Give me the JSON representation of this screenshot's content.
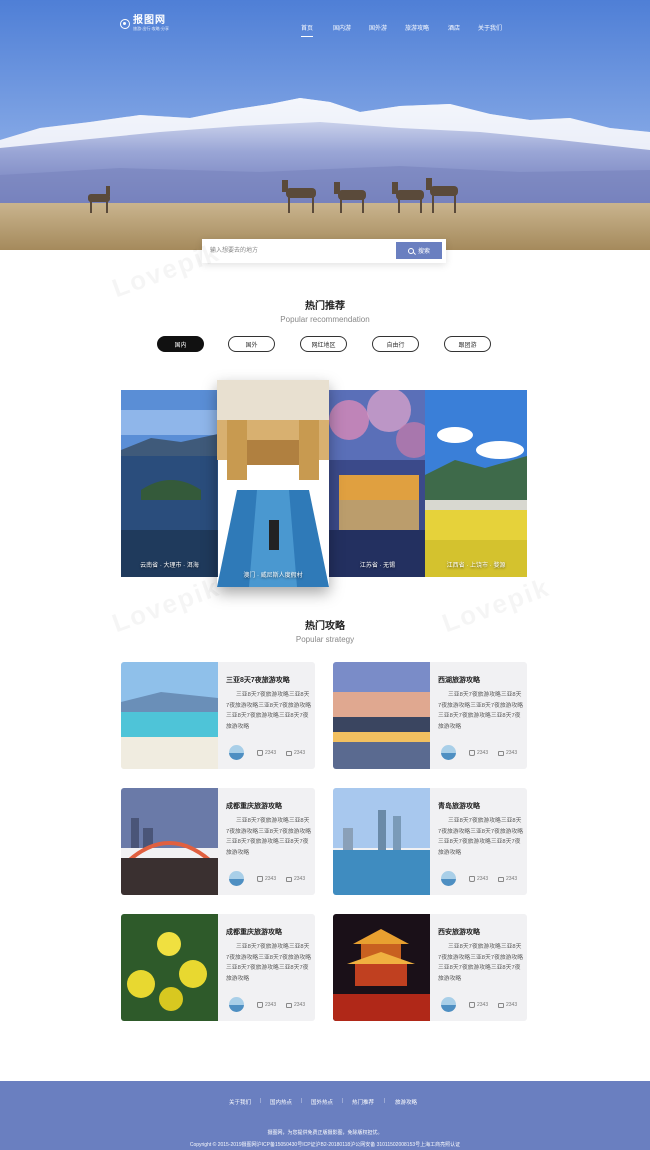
{
  "brand": {
    "name": "报图网",
    "tagline": "旅游·出行·攻略·分享"
  },
  "nav": [
    {
      "label": "首页",
      "active": true
    },
    {
      "label": "国内游",
      "active": false
    },
    {
      "label": "国外游",
      "active": false
    },
    {
      "label": "旅游攻略",
      "active": false
    },
    {
      "label": "酒店",
      "active": false
    },
    {
      "label": "关于我们",
      "active": false
    }
  ],
  "search": {
    "placeholder": "输入想要去的地方",
    "button_label": "搜索"
  },
  "recommend": {
    "title": "热门推荐",
    "subtitle": "Popular recommendation",
    "tabs": [
      {
        "label": "国内",
        "active": true
      },
      {
        "label": "国外",
        "active": false
      },
      {
        "label": "网红地区",
        "active": false
      },
      {
        "label": "自由行",
        "active": false
      },
      {
        "label": "跟团游",
        "active": false
      }
    ],
    "destinations": [
      {
        "label": "云南省 · 大理市 · 洱海"
      },
      {
        "label": "澳门 · 威尼斯人度假村"
      },
      {
        "label": "江苏省 · 无锡"
      },
      {
        "label": "江西省 · 上饶市 · 婺源"
      }
    ]
  },
  "strategy": {
    "title": "热门攻略",
    "subtitle": "Popular strategy",
    "cards": [
      {
        "title": "三亚8天7夜旅游攻略",
        "desc": "三亚8天7夜旅游攻略三亚8天7夜旅游攻略三亚8天7夜旅游攻略三亚8天7夜旅游攻略三亚8天7夜旅游攻略",
        "likes": "2343",
        "comments": "2343"
      },
      {
        "title": "西湖旅游攻略",
        "desc": "三亚8天7夜旅游攻略三亚8天7夜旅游攻略三亚8天7夜旅游攻略三亚8天7夜旅游攻略三亚8天7夜旅游攻略",
        "likes": "2343",
        "comments": "2343"
      },
      {
        "title": "成都重庆旅游攻略",
        "desc": "三亚8天7夜旅游攻略三亚8天7夜旅游攻略三亚8天7夜旅游攻略三亚8天7夜旅游攻略三亚8天7夜旅游攻略",
        "likes": "2343",
        "comments": "2343"
      },
      {
        "title": "青岛旅游攻略",
        "desc": "三亚8天7夜旅游攻略三亚8天7夜旅游攻略三亚8天7夜旅游攻略三亚8天7夜旅游攻略三亚8天7夜旅游攻略",
        "likes": "2343",
        "comments": "2343"
      },
      {
        "title": "成都重庆旅游攻略",
        "desc": "三亚8天7夜旅游攻略三亚8天7夜旅游攻略三亚8天7夜旅游攻略三亚8天7夜旅游攻略三亚8天7夜旅游攻略",
        "likes": "2343",
        "comments": "2343"
      },
      {
        "title": "西安旅游攻略",
        "desc": "三亚8天7夜旅游攻略三亚8天7夜旅游攻略三亚8天7夜旅游攻略三亚8天7夜旅游攻略三亚8天7夜旅游攻略",
        "likes": "2343",
        "comments": "2343"
      }
    ]
  },
  "footer": {
    "links": [
      "关于我们",
      "国内热点",
      "国外热点",
      "热门推荐",
      "旅游攻略"
    ],
    "note": "摄图网，为您提供免费正版摄影图，免除版权担忧。",
    "copyright": "Copyright © 2015-2019摄图网沪ICP备15050430号ICP证沪B2-20180118沪公网安备 31011502008153号上海工商亮照认证"
  },
  "colors": {
    "accent": "#6a7fc0",
    "active_tab": "#111111"
  }
}
